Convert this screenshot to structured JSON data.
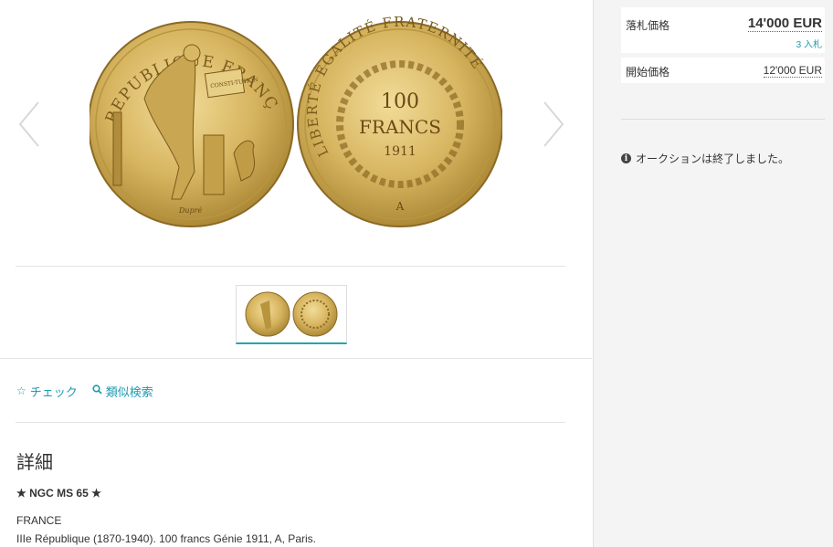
{
  "detail": {
    "actions": [
      {
        "icon": "star-outline-icon",
        "label": "チェック"
      },
      {
        "icon": "search-icon",
        "label": "類似検索"
      }
    ],
    "title": "詳細",
    "grade": "★ NGC MS 65 ★",
    "country": "FRANCE",
    "description": "IIIe République (1870-1940). 100 francs Génie 1911, A, Paris."
  },
  "coin": {
    "obverse_legend": "REPUBLIQUE FRANÇAISE",
    "obverse_tablet": "CONSTI-TUTION",
    "obverse_signature": "Dupré",
    "reverse_legend": "LIBERTÉ ÉGALITÉ FRATERNITÉ",
    "reverse_value_line1": "100",
    "reverse_value_line2": "FRANCS",
    "reverse_year": "1911",
    "reverse_mintmark": "A"
  },
  "auction": {
    "hammer_label": "落札価格",
    "hammer_value": "14'000 EUR",
    "bids": "3 入札",
    "start_label": "開始価格",
    "start_value": "12'000 EUR",
    "status": "オークションは終了しました。"
  },
  "colors": {
    "accent": "#1e9bb0",
    "gold": "#d7b560",
    "gold_dark": "#a5812f",
    "panel_bg": "#f4f4f4"
  }
}
